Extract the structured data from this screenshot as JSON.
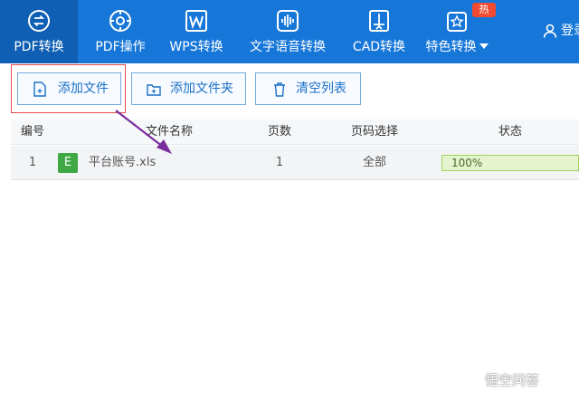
{
  "nav": {
    "items": [
      {
        "label": "PDF转换",
        "icon": "pdf-convert-icon",
        "active": true
      },
      {
        "label": "PDF操作",
        "icon": "pdf-operate-icon"
      },
      {
        "label": "WPS转换",
        "icon": "wps-word-icon"
      },
      {
        "label": "文字语音转换",
        "icon": "audio-wave-icon"
      },
      {
        "label": "CAD转换",
        "icon": "cad-icon"
      },
      {
        "label": "特色转换",
        "icon": "special-convert-icon",
        "badge": "热"
      }
    ],
    "login_label": "登录",
    "colors": {
      "bar": "#1777d8",
      "active": "#0f5fb4",
      "badge": "#f04a32"
    }
  },
  "toolbar": {
    "add_file": "添加文件",
    "add_folder": "添加文件夹",
    "clear_list": "清空列表"
  },
  "table": {
    "columns": [
      "编号",
      "文件名称",
      "页数",
      "页码选择",
      "状态"
    ],
    "rows": [
      {
        "index": "1",
        "type_letter": "E",
        "name": "平台账号.xls",
        "pages": "1",
        "range": "全部",
        "status": "100%",
        "progress": 1.0
      }
    ]
  },
  "watermark": "悟空问答"
}
